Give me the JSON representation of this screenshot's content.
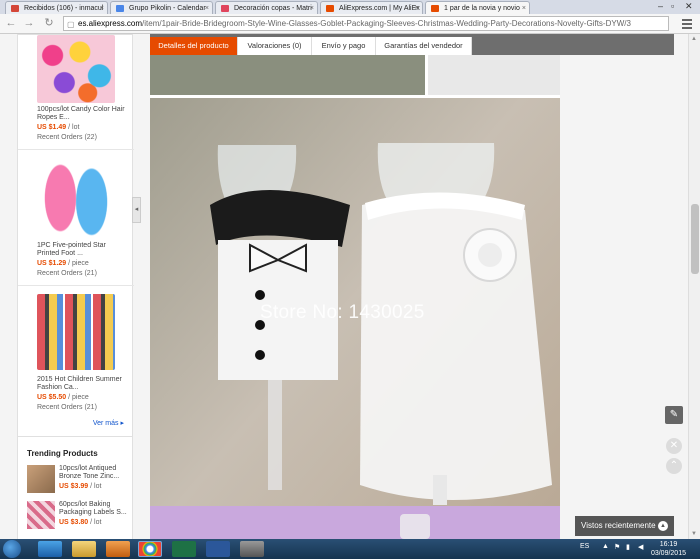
{
  "browser": {
    "tabs": [
      {
        "label": "Recibidos (106) - inmacul",
        "color": "#d44638",
        "active": false
      },
      {
        "label": "Grupo Pikolin - Calendar",
        "color": "#4a86e8",
        "active": false
      },
      {
        "label": "Decoración copas - Matri",
        "color": "#e0455d",
        "active": false
      },
      {
        "label": "AliExpress.com | My AliEx",
        "color": "#e64b00",
        "active": false
      },
      {
        "label": "1 par de la novia y novio",
        "color": "#e64b00",
        "active": true
      }
    ],
    "url_host": "es.aliexpress.com",
    "url_path": "/item/1pair-Bride-Bridegroom-Style-Wine-Glasses-Goblet-Packaging-Sleeves-Christmas-Wedding-Party-Decorations-Novelty-Gifts-DYW/3"
  },
  "main_tabs": [
    {
      "label": "Detalles del producto",
      "active": true
    },
    {
      "label": "Valoraciones (0)",
      "active": false
    },
    {
      "label": "Envío y pago",
      "active": false
    },
    {
      "label": "Garantías del vendedor",
      "active": false
    }
  ],
  "sidebar": {
    "products": [
      {
        "name": "100pcs/lot Candy Color Hair Ropes E...",
        "price": "US $1.49",
        "unit": " / lot",
        "orders": "Recent Orders (22)"
      },
      {
        "name": "1PC Five-pointed Star Printed Foot ...",
        "price": "US $1.29",
        "unit": " / piece",
        "orders": "Recent Orders (21)"
      },
      {
        "name": "2015 Hot Children Summer Fashion Ca...",
        "price": "US $5.50",
        "unit": " / piece",
        "orders": "Recent Orders (21)"
      }
    ],
    "see_more": "Ver más"
  },
  "trending": {
    "title": "Trending Products",
    "items": [
      {
        "name": "10pcs/lot Antiqued Bronze Tone Zinc...",
        "price": "US $3.99",
        "unit": " / lot"
      },
      {
        "name": "60pcs/lot Baking Packaging Labels S...",
        "price": "US $3.80",
        "unit": " / lot"
      }
    ]
  },
  "photo": {
    "watermark": "Store No: 1430025"
  },
  "recently_viewed": "Vistos recientemente",
  "taskbar": {
    "lang": "ES",
    "time": "16:19",
    "date": "03/09/2015"
  },
  "colors": {
    "accent": "#e64b00",
    "tab_bar": "#6e6e6e",
    "link": "#1155cc"
  }
}
